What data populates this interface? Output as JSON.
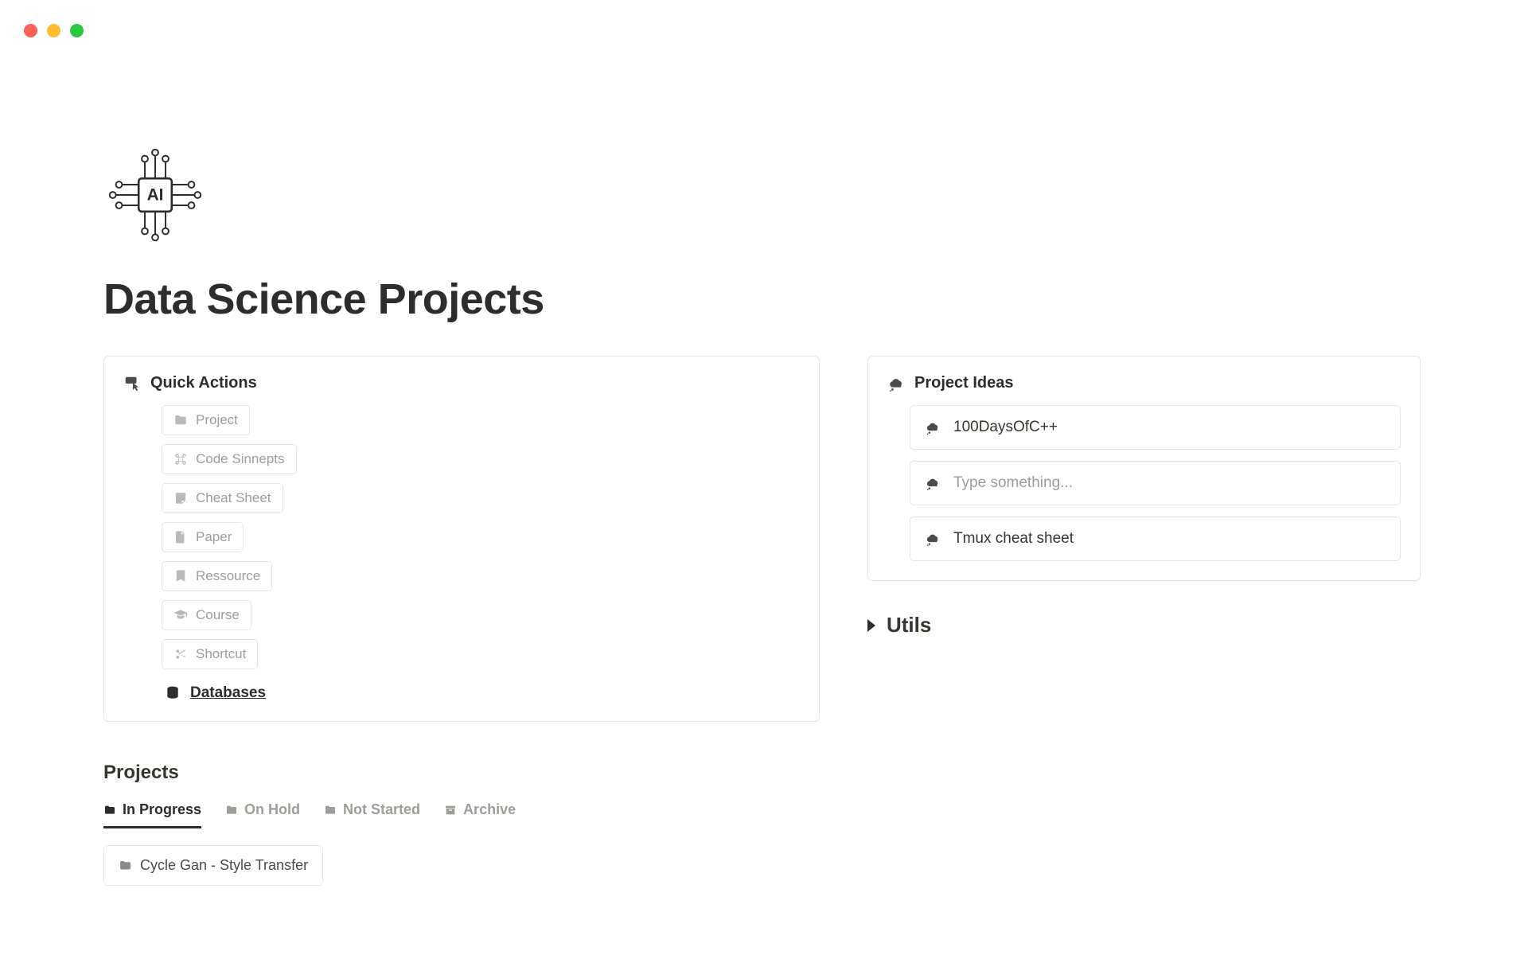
{
  "page": {
    "title": "Data Science Projects"
  },
  "quick_actions": {
    "title": "Quick Actions",
    "items": [
      {
        "label": "Project",
        "icon": "folder"
      },
      {
        "label": "Code Sinnepts",
        "icon": "command"
      },
      {
        "label": "Cheat Sheet",
        "icon": "note"
      },
      {
        "label": "Paper",
        "icon": "document"
      },
      {
        "label": "Ressource",
        "icon": "bookmark"
      },
      {
        "label": "Course",
        "icon": "graduation"
      },
      {
        "label": "Shortcut",
        "icon": "scissors"
      }
    ],
    "databases_label": "Databases"
  },
  "project_ideas": {
    "title": "Project Ideas",
    "items": [
      {
        "label": "100DaysOfC++",
        "placeholder": false
      },
      {
        "label": "Type something...",
        "placeholder": true
      },
      {
        "label": "Tmux cheat sheet",
        "placeholder": false
      }
    ]
  },
  "utils": {
    "title": "Utils"
  },
  "projects": {
    "title": "Projects",
    "tabs": [
      {
        "label": "In Progress",
        "active": true
      },
      {
        "label": "On Hold",
        "active": false
      },
      {
        "label": "Not Started",
        "active": false
      },
      {
        "label": "Archive",
        "active": false
      }
    ],
    "cards": [
      {
        "label": "Cycle Gan - Style Transfer"
      }
    ]
  }
}
